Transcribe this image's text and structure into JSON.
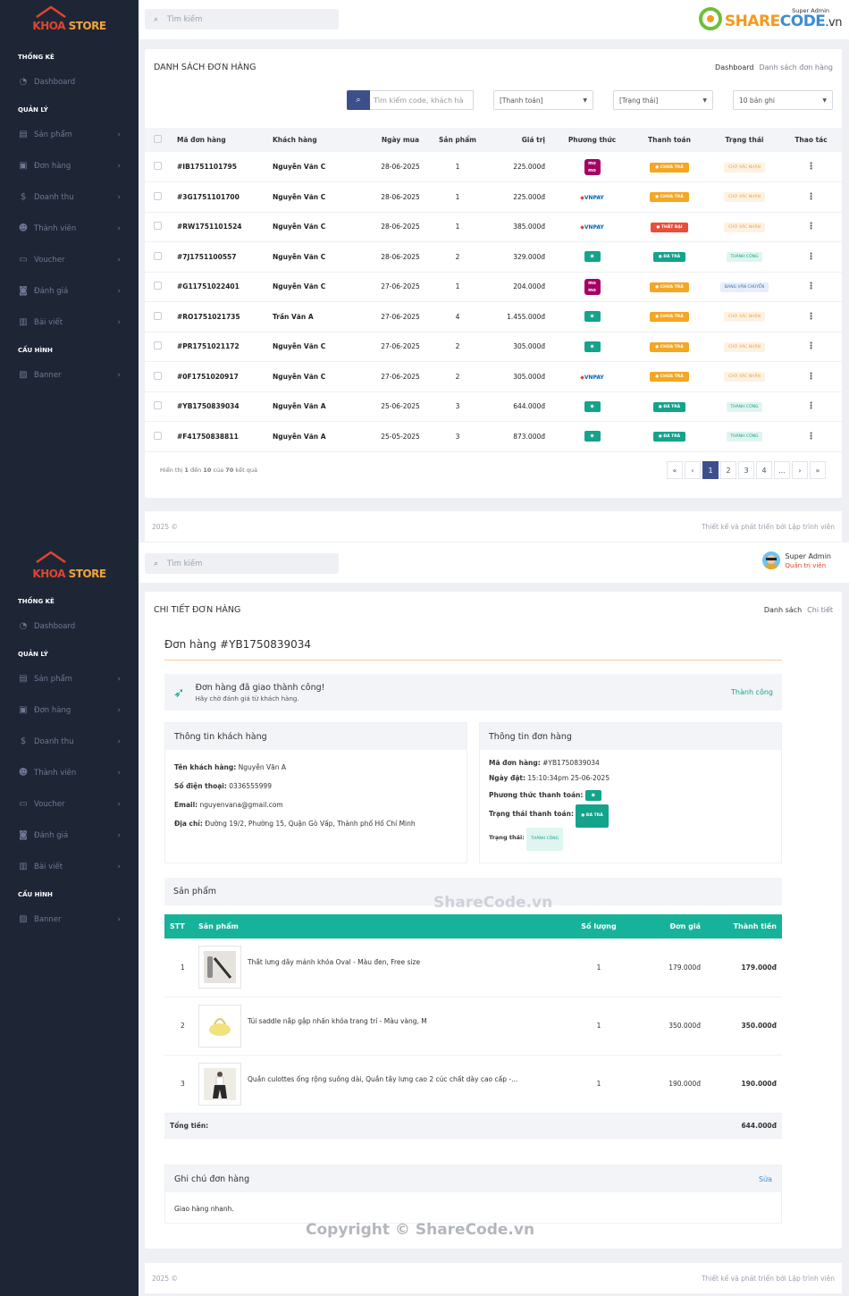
{
  "brand": {
    "name_a": "KHOA",
    "name_b": " STORE"
  },
  "watermark": {
    "top": "SHARECODE.vn",
    "share": "SHARE",
    "code": "CODE",
    "vn": ".vn",
    "mid": "ShareCode.vn",
    "bottom": "Copyright © ShareCode.vn"
  },
  "sidebar": {
    "head1": "THỐNG KÊ",
    "dashboard": "Dashboard",
    "head2": "QUẢN LÝ",
    "items": [
      "Sản phẩm",
      "Đơn hàng",
      "Doanh thu",
      "Thành viên",
      "Voucher",
      "Đánh giá",
      "Bài viết"
    ],
    "head3": "CẤU HÌNH",
    "banner": "Banner"
  },
  "topbar": {
    "search_placeholder": "Tìm kiếm",
    "user_name": "Super Admin",
    "user_role": "Quản trị viên"
  },
  "list": {
    "title": "DANH SÁCH ĐƠN HÀNG",
    "breadcrumb": {
      "home": "Dashboard",
      "current": "Danh sách đơn hàng"
    },
    "search_placeholder": "Tìm kiếm code, khách hà",
    "filter_payment": "[Thanh toán]",
    "filter_status": "[Trạng thái]",
    "filter_page": "10 bản ghi",
    "headers": [
      "Mã đơn hàng",
      "Khách hàng",
      "Ngày mua",
      "Sản phẩm",
      "Giá trị",
      "Phương thức",
      "Thanh toán",
      "Trạng thái",
      "Thao tác"
    ],
    "rows": [
      {
        "code": "#IB1751101795",
        "customer": "Nguyễn Văn C",
        "date": "28-06-2025",
        "qty": "1",
        "value": "225.000đ",
        "method": "momo",
        "pay": "CHƯA TRẢ",
        "pay_type": "unpaid",
        "status": "CHỜ XÁC NHẬN",
        "status_type": "wait"
      },
      {
        "code": "#3G1751101700",
        "customer": "Nguyễn Văn C",
        "date": "28-06-2025",
        "qty": "1",
        "value": "225.000đ",
        "method": "vnpay",
        "pay": "CHƯA TRẢ",
        "pay_type": "unpaid",
        "status": "CHỜ XÁC NHẬN",
        "status_type": "wait"
      },
      {
        "code": "#RW1751101524",
        "customer": "Nguyễn Văn C",
        "date": "28-06-2025",
        "qty": "1",
        "value": "385.000đ",
        "method": "vnpay",
        "pay": "THẤT BẠI",
        "pay_type": "fail",
        "status": "CHỜ XÁC NHẬN",
        "status_type": "wait"
      },
      {
        "code": "#7J1751100557",
        "customer": "Nguyễn Văn C",
        "date": "28-06-2025",
        "qty": "2",
        "value": "329.000đ",
        "method": "cash",
        "pay": "ĐÃ TRẢ",
        "pay_type": "paid",
        "status": "THÀNH CÔNG",
        "status_type": "ok"
      },
      {
        "code": "#G11751022401",
        "customer": "Nguyễn Văn C",
        "date": "27-06-2025",
        "qty": "1",
        "value": "204.000đ",
        "method": "momo",
        "pay": "CHƯA TRẢ",
        "pay_type": "unpaid",
        "status": "ĐANG VẬN CHUYỂN",
        "status_type": "ship"
      },
      {
        "code": "#RO1751021735",
        "customer": "Trần Văn A",
        "date": "27-06-2025",
        "qty": "4",
        "value": "1.455.000đ",
        "method": "cash",
        "pay": "CHƯA TRẢ",
        "pay_type": "unpaid",
        "status": "CHỜ XÁC NHẬN",
        "status_type": "wait"
      },
      {
        "code": "#PR1751021172",
        "customer": "Nguyễn Văn C",
        "date": "27-06-2025",
        "qty": "2",
        "value": "305.000đ",
        "method": "cash",
        "pay": "CHƯA TRẢ",
        "pay_type": "unpaid",
        "status": "CHỜ XÁC NHẬN",
        "status_type": "wait"
      },
      {
        "code": "#0F1751020917",
        "customer": "Nguyễn Văn C",
        "date": "27-06-2025",
        "qty": "2",
        "value": "305.000đ",
        "method": "vnpay",
        "pay": "CHƯA TRẢ",
        "pay_type": "unpaid",
        "status": "CHỜ XÁC NHẬN",
        "status_type": "wait"
      },
      {
        "code": "#YB1750839034",
        "customer": "Nguyễn Văn A",
        "date": "25-06-2025",
        "qty": "3",
        "value": "644.000đ",
        "method": "cash",
        "pay": "ĐÃ TRẢ",
        "pay_type": "paid",
        "status": "THÀNH CÔNG",
        "status_type": "ok"
      },
      {
        "code": "#F41750838811",
        "customer": "Nguyễn Văn A",
        "date": "25-05-2025",
        "qty": "3",
        "value": "873.000đ",
        "method": "cash",
        "pay": "ĐÃ TRẢ",
        "pay_type": "paid",
        "status": "THÀNH CÔNG",
        "status_type": "ok"
      }
    ],
    "summary": {
      "a": "Hiển thị ",
      "b": "1",
      "c": " đến ",
      "d": "10",
      "e": " của ",
      "f": "70",
      "g": " kết quả"
    },
    "pages": [
      "«",
      "‹",
      "1",
      "2",
      "3",
      "4",
      "...",
      "›",
      "»"
    ]
  },
  "footer": {
    "left": "2025 ©",
    "right": "Thiết kế và phát triển bởi Lập trình viên"
  },
  "detail": {
    "title": "CHI TIẾT ĐƠN HÀNG",
    "breadcrumb": {
      "home": "Danh sách",
      "current": "Chi tiết"
    },
    "order_title": "Đơn hàng #YB1750839034",
    "alert_title": "Đơn hàng đã giao thành công!",
    "alert_sub": "Hãy chờ đánh giá từ khách hàng.",
    "alert_status": "Thành công",
    "customer": {
      "heading": "Thông tin khách hàng",
      "name_label": "Tên khách hàng:",
      "name": " Nguyễn Văn A",
      "phone_label": "Số điện thoại:",
      "phone": " 0336555999",
      "email_label": "Email:",
      "email": " nguyenvana@gmail.com",
      "address_label": "Địa chỉ:",
      "address": " Đường 19/2, Phường 15, Quận Gò Vấp, Thành phố Hồ Chí Minh"
    },
    "order": {
      "heading": "Thông tin đơn hàng",
      "code_label": "Mã đơn hàng:",
      "code": " #YB1750839034",
      "date_label": "Ngày đặt:",
      "date": " 15:10:34pm 25-06-2025",
      "method_label": "Phương thức thanh toán:",
      "pay_label": "Trạng thái thanh toán:",
      "pay": "ĐÃ TRẢ",
      "status_label": "Trạng thái:",
      "status": "THÀNH CÔNG"
    },
    "products": {
      "heading": "Sản phẩm",
      "headers": [
        "STT",
        "Sản phẩm",
        "Số lượng",
        "Đơn giá",
        "Thành tiền"
      ],
      "rows": [
        {
          "idx": "1",
          "name": "Thắt lưng dây mảnh khóa Oval - Màu đen, Free size",
          "qty": "1",
          "price": "179.000đ",
          "total": "179.000đ"
        },
        {
          "idx": "2",
          "name": "Túi saddle nắp gập nhấn khóa trang trí - Màu vàng, M",
          "qty": "1",
          "price": "350.000đ",
          "total": "350.000đ"
        },
        {
          "idx": "3",
          "name": "Quần culottes ống rộng suông dài, Quần tây lưng cao 2 cúc chất dày cao cấp -...",
          "qty": "1",
          "price": "190.000đ",
          "total": "190.000đ"
        }
      ],
      "total_label": "Tổng tiền:",
      "total": "644.000đ"
    },
    "note": {
      "heading": "Ghi chú đơn hàng",
      "edit": "Sửa",
      "text": "Giao hàng nhanh."
    }
  }
}
